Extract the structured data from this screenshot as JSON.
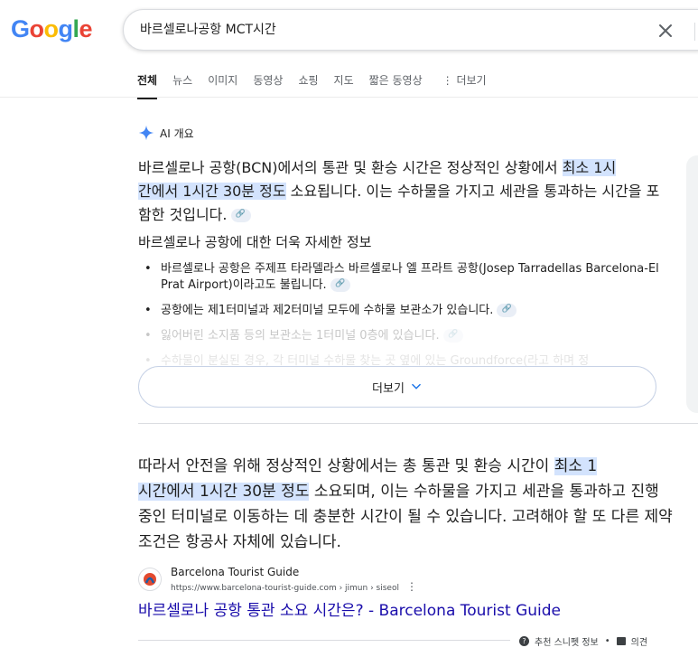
{
  "logo": {
    "letters": [
      "G",
      "o",
      "o",
      "g",
      "l",
      "e"
    ],
    "colors": [
      "#4285F4",
      "#EA4335",
      "#FBBC05",
      "#4285F4",
      "#34A853",
      "#EA4335"
    ]
  },
  "search": {
    "query": "바르셀로나공항 MCT시간"
  },
  "tabs": [
    {
      "label": "전체",
      "active": true
    },
    {
      "label": "뉴스"
    },
    {
      "label": "이미지"
    },
    {
      "label": "동영상"
    },
    {
      "label": "쇼핑"
    },
    {
      "label": "지도"
    },
    {
      "label": "짧은 동영상"
    }
  ],
  "more_tab": "더보기",
  "ai": {
    "label": "AI 개요",
    "p1_a": "바르셀로나 공항(BCN)에서의 통관 및 환승 시간은 정상적인 상황에서 ",
    "p1_hl1": "최소 1시",
    "p1_hl2": "간에서 1시간 30분 정도",
    "p1_b": " 소요됩니다. 이는 수하물을 가지고 세관을 통과하는 시간을 포함한 것입니다.",
    "subheading": "바르셀로나 공항에 대한 더욱 자세한 정보",
    "bullets": [
      "바르셀로나 공항은 주제프 타라델라스 바르셀로나 엘 프라트 공항(Josep Tarradellas Barcelona-El Prat Airport)이라고도 불립니다.",
      "공항에는 제1터미널과 제2터미널 모두에 수하물 보관소가 있습니다.",
      "잃어버린 소지품 등의 보관소는 1터미널 0층에 있습니다.",
      "수하물이 분실된 경우, 각 터미널 수하물 찾는 곳 옆에 있는 Groundforce(라고 하며 정"
    ],
    "show_more": "더보기"
  },
  "main_para": {
    "a": "따라서 안전을 위해 정상적인 상황에서는 총 통관 및 환승 시간이 ",
    "hl1": "최소 1",
    "hl2": "시간에서 1시간 30분 정도",
    "b": " 소요되며, 이는 수하물을 가지고 세관을 통과하고 진행 중인 터미널로 이동하는 데 충분한 시간이 될 수 있습니다. 고려해야 할 또 다른 제약 조건은 항공사 자체에 있습니다."
  },
  "source": {
    "name": "Barcelona Tourist Guide",
    "url": "https://www.barcelona-tourist-guide.com › jimun › siseol",
    "title": "바르셀로나 공항 통관 소요 시간은? - Barcelona Tourist Guide"
  },
  "footer": {
    "snippet": "추천 스니펫 정보",
    "dot": "•",
    "feedback": "의견"
  }
}
